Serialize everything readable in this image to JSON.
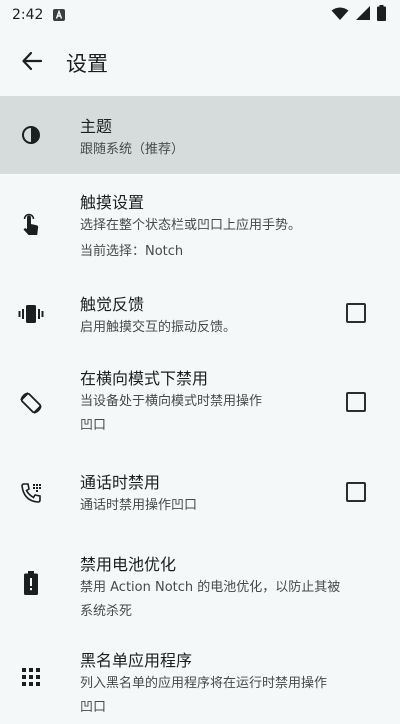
{
  "status": {
    "time": "2:42"
  },
  "app_bar": {
    "title": "设置"
  },
  "items": [
    {
      "title": "主题",
      "sub": "跟随系统（推荐）"
    },
    {
      "title": "触摸设置",
      "sub": "选择在整个状态栏或凹口上应用手势。",
      "sub2": "当前选择：Notch"
    },
    {
      "title": "触觉反馈",
      "sub": "启用触摸交互的振动反馈。"
    },
    {
      "title": "在横向模式下禁用",
      "sub": "当设备处于横向模式时禁用操作",
      "sub2": "凹口"
    },
    {
      "title": "通话时禁用",
      "sub": "通话时禁用操作凹口"
    },
    {
      "title": "禁用电池优化",
      "sub": "禁用 Action Notch 的电池优化，以防止其被",
      "sub2": "系统杀死"
    },
    {
      "title": "黑名单应用程序",
      "sub": "列入黑名单的应用程序将在运行时禁用操作",
      "sub2": "凹口"
    }
  ],
  "icons": {
    "back": "arrow-back-icon",
    "theme": "contrast-icon",
    "touch": "touch-app-icon",
    "haptic": "vibration-icon",
    "landscape": "screen-rotation-icon",
    "call": "phone-in-talk-icon",
    "battery": "battery-alert-icon",
    "blacklist": "apps-grid-icon"
  },
  "colors": {
    "background": "#f4f8f8",
    "selected": "#d6dbdb",
    "text": "#1b1f20",
    "subtext": "#464a4b"
  }
}
